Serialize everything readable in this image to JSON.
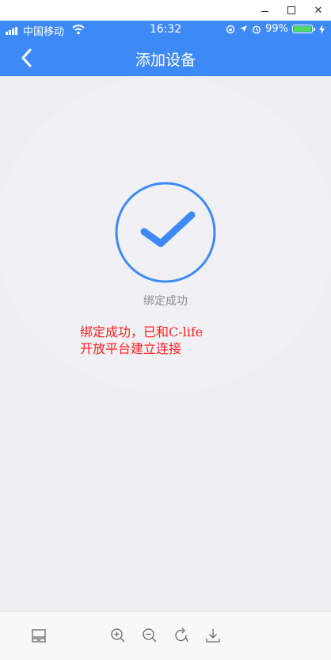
{
  "window": {
    "minimize_icon": "minimize-icon",
    "maximize_icon": "maximize-icon",
    "close_label": "✕"
  },
  "status_bar": {
    "carrier": "中国移动",
    "time": "16:32",
    "battery_percent": "99%",
    "battery_level": 0.99
  },
  "nav": {
    "title": "添加设备",
    "back_icon": "chevron-left-icon"
  },
  "main": {
    "status_text": "绑定成功",
    "annotation_line1": "绑定成功，已和C-life",
    "annotation_line2": "开放平台建立连接",
    "icon": "checkmark-circle-icon"
  },
  "toolbar": {
    "icons": [
      "layout-icon",
      "zoom-in-icon",
      "zoom-out-icon",
      "rotate-icon",
      "download-icon"
    ]
  },
  "colors": {
    "accent": "#3d8af7",
    "annotation": "#ff2020",
    "background": "#eeeef3"
  }
}
